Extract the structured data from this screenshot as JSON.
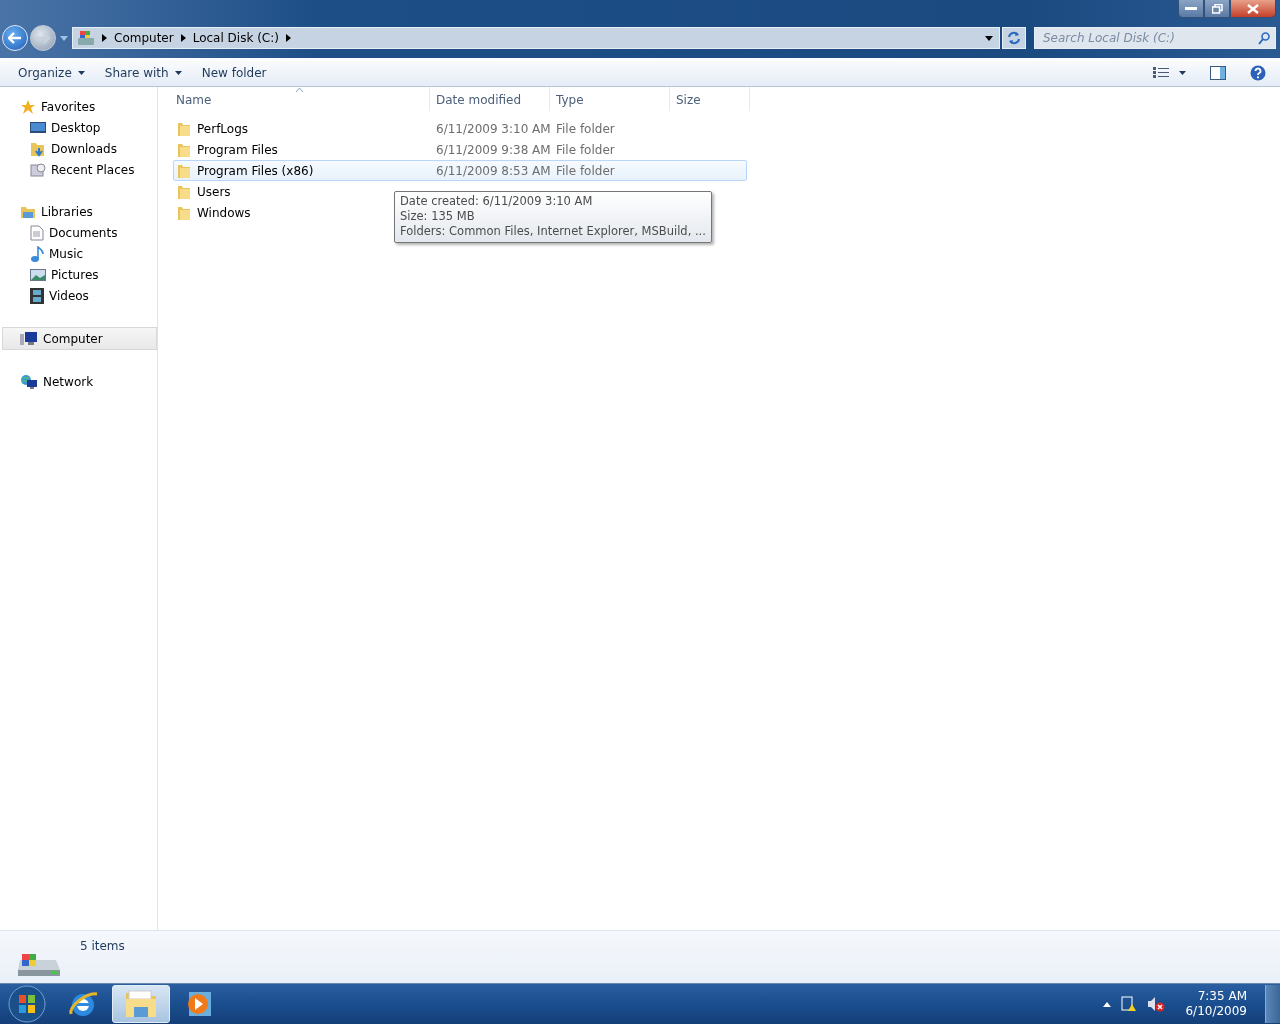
{
  "address_bar": {
    "crumbs": [
      "Computer",
      "Local Disk (C:)"
    ]
  },
  "search": {
    "placeholder": "Search Local Disk (C:)"
  },
  "toolbar": {
    "buttons": [
      {
        "label": "Organize",
        "dropdown": true
      },
      {
        "label": "Share with",
        "dropdown": true
      },
      {
        "label": "New folder",
        "dropdown": false
      }
    ]
  },
  "nav": [
    {
      "label": "Favorites",
      "selected": false,
      "children": [
        {
          "label": "Desktop"
        },
        {
          "label": "Downloads"
        },
        {
          "label": "Recent Places"
        }
      ]
    },
    {
      "label": "Libraries",
      "selected": false,
      "children": [
        {
          "label": "Documents"
        },
        {
          "label": "Music"
        },
        {
          "label": "Pictures"
        },
        {
          "label": "Videos"
        }
      ]
    },
    {
      "label": "Computer",
      "selected": true
    },
    {
      "label": "Network",
      "selected": false
    }
  ],
  "table": {
    "columns": [
      "Name",
      "Date modified",
      "Type",
      "Size"
    ],
    "rows": [
      {
        "name": "PerfLogs",
        "date": "6/11/2009 3:10 AM",
        "type": "File folder",
        "selected": false
      },
      {
        "name": "Program Files",
        "date": "6/11/2009 9:38 AM",
        "type": "File folder",
        "selected": false
      },
      {
        "name": "Program Files (x86)",
        "date": "6/11/2009 8:53 AM",
        "type": "File folder",
        "selected": true
      },
      {
        "name": "Users",
        "selected": false
      },
      {
        "name": "Windows",
        "selected": false
      }
    ]
  },
  "tooltip": {
    "lines": [
      "Date created: 6/11/2009 3:10 AM",
      "Size: 135 MB",
      "Folders: Common Files, Internet Explorer, MSBuild, ..."
    ]
  },
  "status_bar": {
    "text": "5 items"
  },
  "taskbar": {
    "apps": [
      {
        "kind": "ie",
        "selected": false
      },
      {
        "kind": "explorer",
        "selected": true
      },
      {
        "kind": "media",
        "selected": false
      }
    ],
    "clock": {
      "time": "7:35 AM",
      "date": "6/10/2009"
    }
  }
}
